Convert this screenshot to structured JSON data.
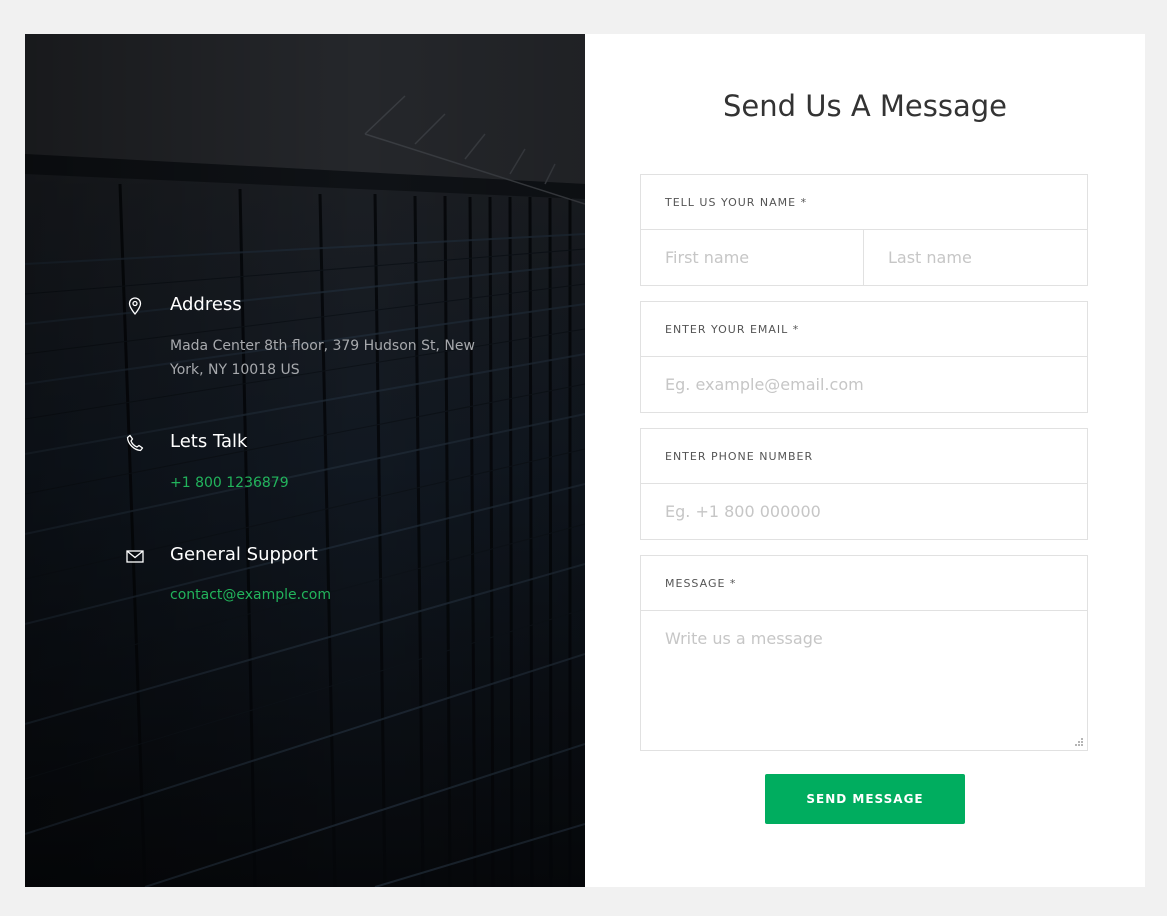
{
  "contact_info": {
    "address": {
      "icon": "map-pin-icon",
      "title": "Address",
      "text": "Mada Center 8th floor, 379 Hudson St, New York, NY 10018 US"
    },
    "talk": {
      "icon": "phone-icon",
      "title": "Lets Talk",
      "text": "+1 800 1236879"
    },
    "support": {
      "icon": "mail-icon",
      "title": "General Support",
      "text": "contact@example.com"
    },
    "link_color": "#22b45c"
  },
  "form": {
    "heading": "Send Us A Message",
    "name": {
      "label": "TELL US YOUR NAME *",
      "first_placeholder": "First name",
      "last_placeholder": "Last name"
    },
    "email": {
      "label": "ENTER YOUR EMAIL *",
      "placeholder": "Eg. example@email.com"
    },
    "phone": {
      "label": "ENTER PHONE NUMBER",
      "placeholder": "Eg. +1 800 000000"
    },
    "message": {
      "label": "MESSAGE *",
      "placeholder": "Write us a message"
    },
    "submit_label": "SEND MESSAGE",
    "accent_color": "#00ad5f"
  }
}
